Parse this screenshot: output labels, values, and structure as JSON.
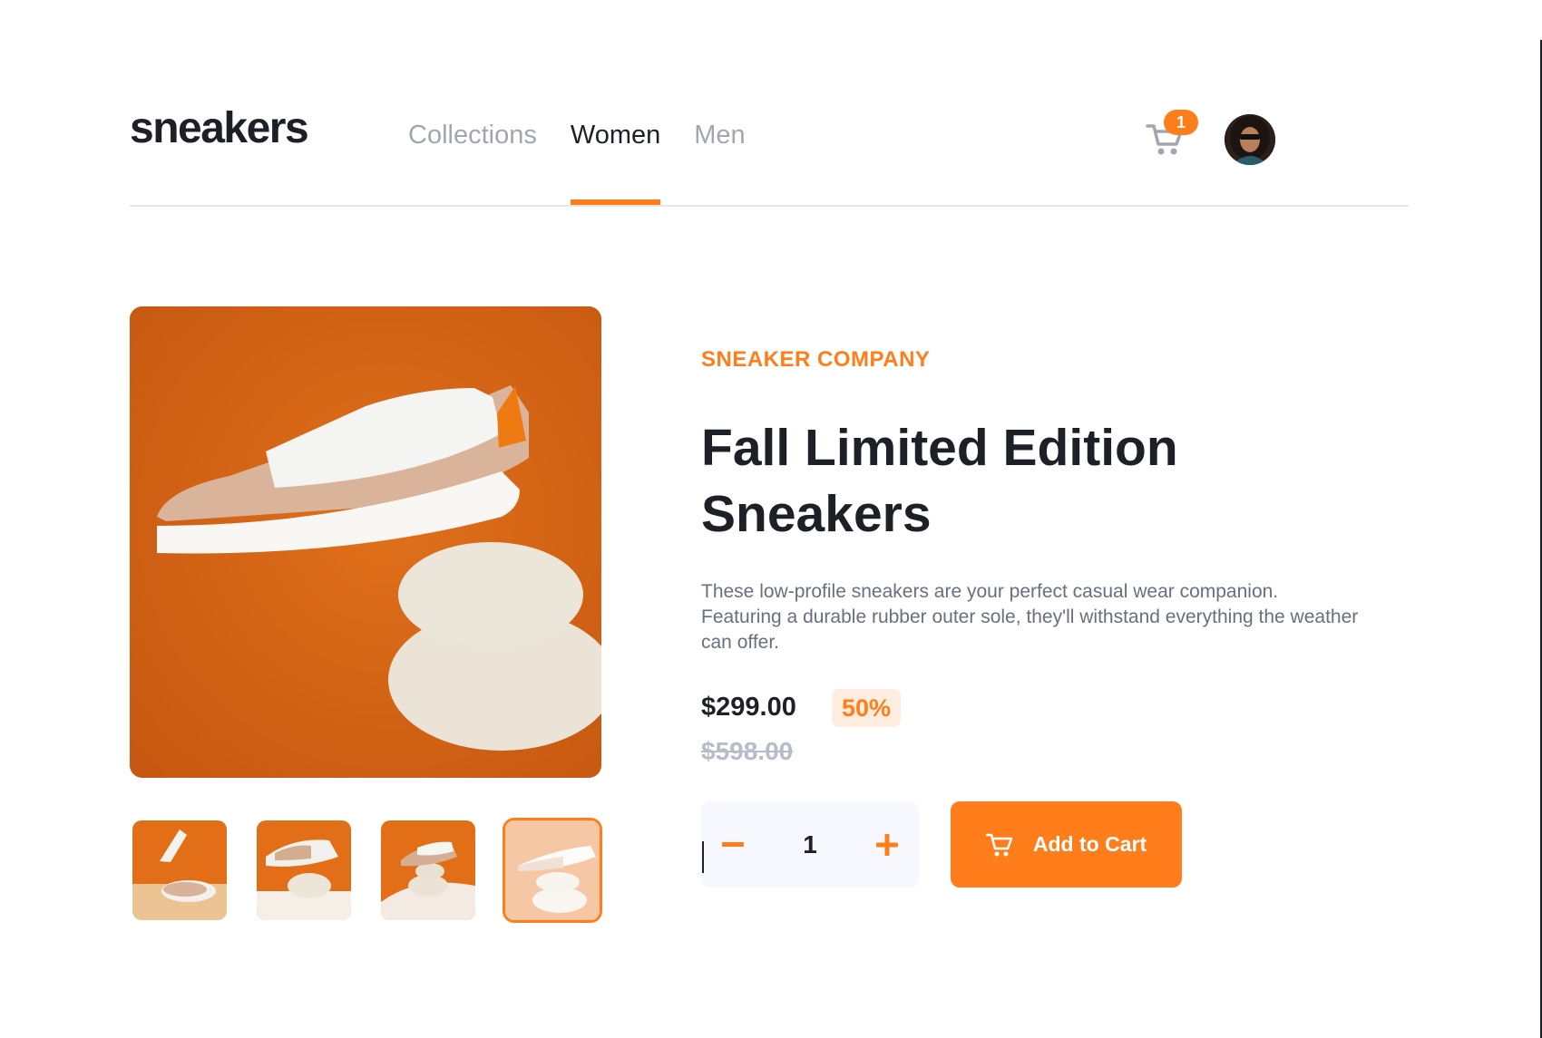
{
  "header": {
    "logo": "sneakers",
    "nav": [
      {
        "label": "Collections",
        "active": false
      },
      {
        "label": "Women",
        "active": true
      },
      {
        "label": "Men",
        "active": false
      }
    ],
    "cart_count": "1",
    "cart_icon": "cart-icon",
    "avatar_icon": "user-avatar"
  },
  "product": {
    "company": "SNEAKER COMPANY",
    "title_line1": "Fall Limited Edition",
    "title_line2": "Sneakers",
    "description": "These low-profile sneakers are your perfect casual wear companion. Featuring a durable rubber outer sole, they'll withstand everything the weather can offer.",
    "price": "$299.00",
    "discount": "50%",
    "original_price": "$598.00",
    "quantity": "1",
    "add_to_cart_label": "Add to Cart"
  },
  "gallery": {
    "thumbnails": [
      "thumbnail-1",
      "thumbnail-2",
      "thumbnail-3",
      "thumbnail-4"
    ],
    "selected_index": 3
  },
  "colors": {
    "accent": "#ff7e1b",
    "accent_pale": "#ffede0",
    "text_dark": "#1d2026",
    "text_muted": "#68707d",
    "surface": "#f6f8fd"
  }
}
